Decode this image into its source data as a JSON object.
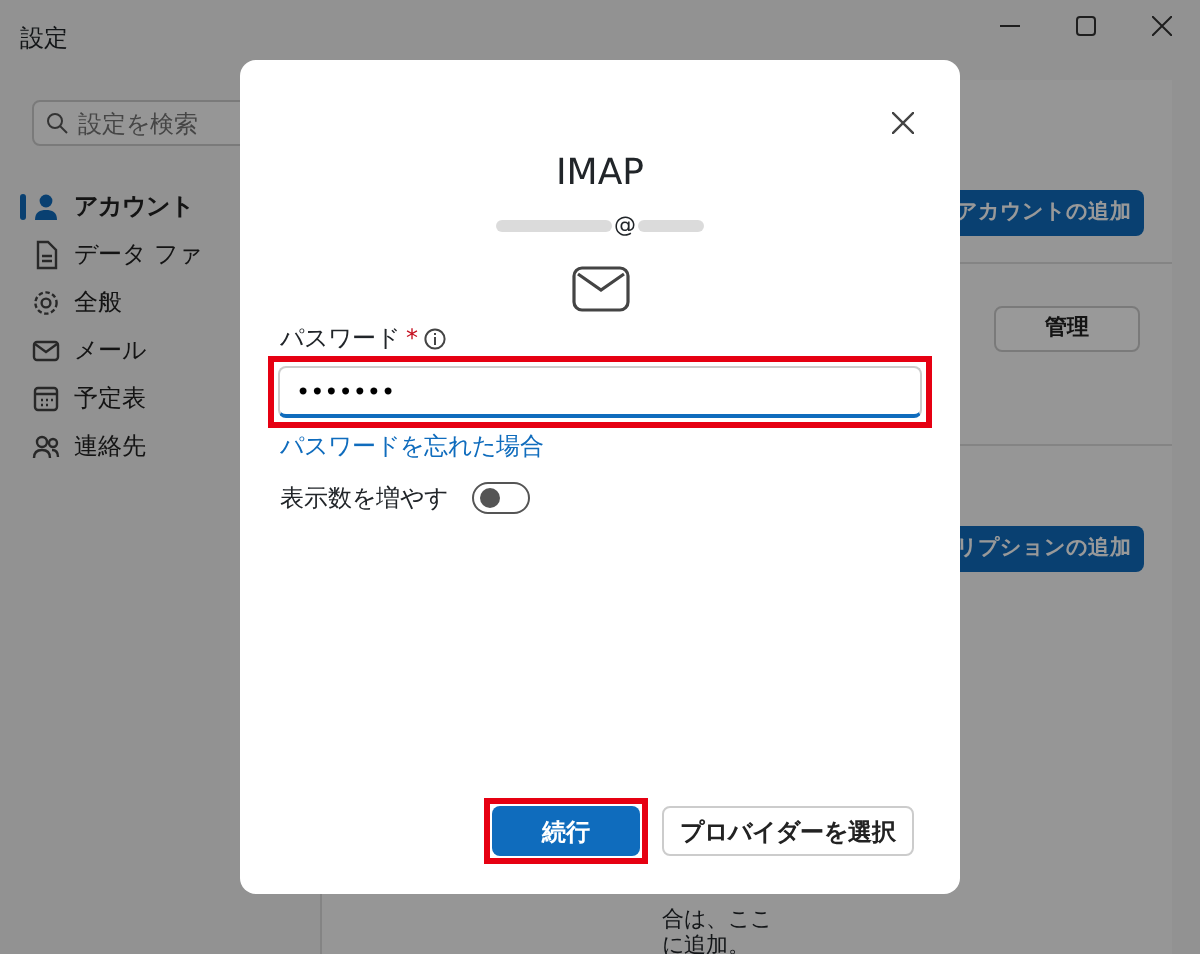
{
  "window": {
    "title": "設定",
    "search": {
      "placeholder": "設定を検索"
    }
  },
  "sidebar": {
    "items": [
      {
        "label": "アカウント",
        "kind": "person",
        "selected": true
      },
      {
        "label": "データ ファ",
        "kind": "file",
        "selected": false
      },
      {
        "label": "全般",
        "kind": "gear",
        "selected": false
      },
      {
        "label": "メール",
        "kind": "mail",
        "selected": false
      },
      {
        "label": "予定表",
        "kind": "calendar",
        "selected": false
      },
      {
        "label": "連絡先",
        "kind": "people",
        "selected": false
      }
    ]
  },
  "content": {
    "buttons": [
      {
        "label": "アカウントの追加",
        "kind": "primary"
      },
      {
        "label": "管理",
        "kind": "secondary"
      },
      {
        "label": "リプションの追加",
        "kind": "primary"
      }
    ],
    "text_lines": [
      "合は、ここ",
      "に追加。"
    ]
  },
  "dialog": {
    "title": "IMAP",
    "email": "@",
    "password": {
      "label": "パスワード",
      "required_mark": "*",
      "value": "•••••••",
      "highlighted": true
    },
    "forgot_link": "パスワードを忘れた場合",
    "toggle": {
      "label": "表示数を増やす",
      "on": false
    },
    "buttons": [
      {
        "label": "続行",
        "kind": "primary",
        "highlighted": true
      },
      {
        "label": "プロバイダーを選択",
        "kind": "secondary",
        "highlighted": false
      }
    ]
  }
}
